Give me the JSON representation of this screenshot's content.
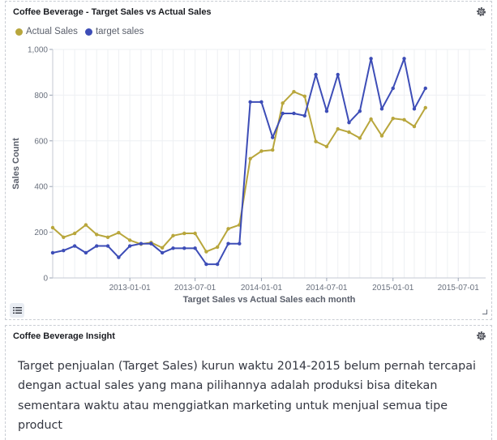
{
  "chart_panel": {
    "title": "Coffee Beverage - Target Sales vs Actual Sales",
    "gear_icon": "gear-icon",
    "legend_toggle_icon": "list-icon"
  },
  "insight_panel": {
    "title": "Coffee Beverage Insight",
    "gear_icon": "gear-icon",
    "text": "Target penjualan (Target Sales) kurun waktu 2014-2015 belum pernah tercapai dengan actual sales yang mana pilihannya adalah produksi bisa ditekan sementara waktu atau menggiatkan marketing untuk menjual semua tipe product"
  },
  "colors": {
    "actual": "#b8a63c",
    "target": "#3d4db7"
  },
  "chart_data": {
    "type": "line",
    "xlabel": "Target Sales vs Actual Sales each month",
    "ylabel": "Sales Count",
    "ylim": [
      0,
      1000
    ],
    "y_ticks": [
      "0",
      "200",
      "400",
      "600",
      "800",
      "1,000"
    ],
    "y_tick_values": [
      0,
      200,
      400,
      600,
      800,
      1000
    ],
    "x_ticks": [
      "2013-01-01",
      "2013-07-01",
      "2014-01-01",
      "2014-07-01",
      "2015-01-01",
      "2015-07-01"
    ],
    "x_range": [
      "2012-06-01",
      "2015-09-15"
    ],
    "x": [
      "2012-06-01",
      "2012-07-01",
      "2012-08-01",
      "2012-09-01",
      "2012-10-01",
      "2012-11-01",
      "2012-12-01",
      "2013-01-01",
      "2013-02-01",
      "2013-03-01",
      "2013-04-01",
      "2013-05-01",
      "2013-06-01",
      "2013-07-01",
      "2013-08-01",
      "2013-09-01",
      "2013-10-01",
      "2013-11-01",
      "2013-12-01",
      "2014-01-01",
      "2014-02-01",
      "2014-03-01",
      "2014-04-01",
      "2014-05-01",
      "2014-06-01",
      "2014-07-01",
      "2014-08-01",
      "2014-09-01",
      "2014-10-01",
      "2014-11-01",
      "2014-12-01",
      "2015-01-01",
      "2015-02-01",
      "2015-03-01",
      "2015-04-01",
      "2015-05-01",
      "2015-06-01",
      "2015-07-01",
      "2015-08-01"
    ],
    "grid": true,
    "legend": "top-left",
    "series": [
      {
        "name": "Actual Sales",
        "values": [
          220,
          178,
          195,
          232,
          190,
          178,
          198,
          165,
          148,
          155,
          132,
          185,
          195,
          195,
          115,
          135,
          215,
          232,
          522,
          555,
          560,
          765,
          815,
          795,
          597,
          575,
          652,
          638,
          612,
          695,
          622,
          698,
          692,
          663,
          745
        ]
      },
      {
        "name": "target sales",
        "values": [
          110,
          120,
          140,
          110,
          140,
          140,
          90,
          140,
          150,
          150,
          110,
          130,
          130,
          130,
          60,
          60,
          150,
          150,
          770,
          770,
          615,
          720,
          720,
          710,
          890,
          730,
          890,
          680,
          730,
          960,
          740,
          830,
          960,
          740,
          830
        ]
      }
    ]
  }
}
